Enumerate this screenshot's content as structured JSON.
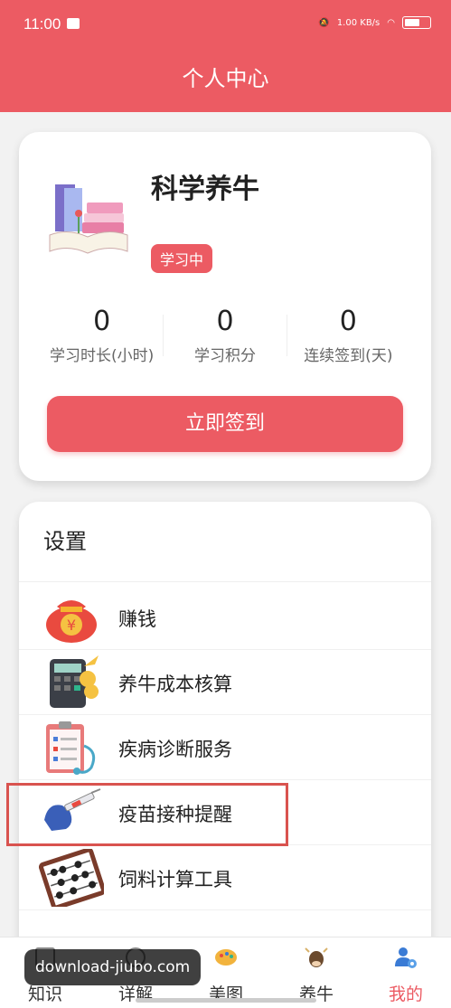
{
  "status_bar": {
    "time": "11:00",
    "speed": "1.00 KB/s"
  },
  "app_bar": {
    "title": "个人中心"
  },
  "profile": {
    "name": "科学养牛",
    "badge": "学习中",
    "stats": [
      {
        "value": "0",
        "label": "学习时长(小时)"
      },
      {
        "value": "0",
        "label": "学习积分"
      },
      {
        "value": "0",
        "label": "连续签到(天)"
      }
    ],
    "signin_label": "立即签到"
  },
  "settings": {
    "title": "设置",
    "items": [
      {
        "label": "赚钱",
        "icon": "money-bag-icon"
      },
      {
        "label": "养牛成本核算",
        "icon": "calculator-icon"
      },
      {
        "label": "疾病诊断服务",
        "icon": "clipboard-stethoscope-icon"
      },
      {
        "label": "疫苗接种提醒",
        "icon": "syringe-icon"
      },
      {
        "label": "饲料计算工具",
        "icon": "abacus-icon"
      }
    ]
  },
  "tab_bar": {
    "tabs": [
      {
        "label": "知识",
        "icon": "book-icon"
      },
      {
        "label": "详解",
        "icon": "question-icon"
      },
      {
        "label": "美图",
        "icon": "palette-icon"
      },
      {
        "label": "养牛",
        "icon": "cow-icon"
      },
      {
        "label": "我的",
        "icon": "user-settings-icon"
      }
    ],
    "active_index": 4
  },
  "watermark": "download-jiubo.com",
  "colors": {
    "accent": "#ec5b63",
    "background": "#f2f2f2",
    "highlight_border": "#d9534f"
  }
}
